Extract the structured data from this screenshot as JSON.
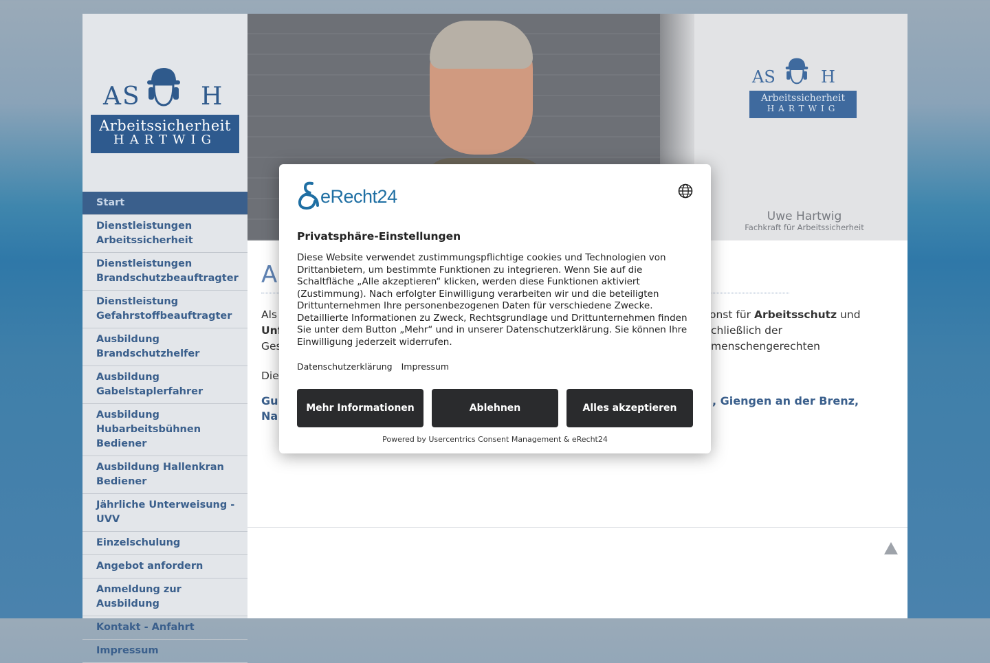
{
  "logo": {
    "letters_left": "AS",
    "letters_right": "H",
    "line1": "Arbeitssicherheit",
    "line2": "HARTWIG"
  },
  "nav": {
    "items": [
      {
        "label": "Start"
      },
      {
        "label": "Dienstleistungen Arbeitssicherheit"
      },
      {
        "label": "Dienstleistungen Brandschutzbeauftragter"
      },
      {
        "label": "Dienstleistung Gefahrstoffbeauftragter"
      },
      {
        "label": "Ausbildung Brandschutzhelfer"
      },
      {
        "label": "Ausbildung Gabelstaplerfahrer"
      },
      {
        "label": "Ausbildung Hubarbeitsbühnen Bediener"
      },
      {
        "label": "Ausbildung Hallenkran Bediener"
      },
      {
        "label": "Jährliche Unterweisung - UVV"
      },
      {
        "label": "Einzelschulung"
      },
      {
        "label": "Angebot anfordern"
      },
      {
        "label": "Anmeldung zur Ausbildung"
      },
      {
        "label": "Kontakt - Anfahrt"
      },
      {
        "label": "Impressum"
      }
    ]
  },
  "header": {
    "person_name": "Uwe Hartwig",
    "person_role": "Fachkraft für Arbeitssicherheit"
  },
  "content": {
    "heading": "A",
    "p1_start": "Als",
    "p1_tail": "onst für",
    "p1_bold1": "Arbeitsschutz",
    "p1_and": "und",
    "p2_start": "Unf",
    "p2_tail": "chließlich der menschengerechten",
    "p3_start": "Ges",
    "p4_start": "Die",
    "locations_start": "Gu",
    "locations_tail": ", Giengen an der Brenz,",
    "locations_l2": "Na"
  },
  "consent": {
    "brand": "eRecht24",
    "title": "Privatsphäre-Einstellungen",
    "description": "Diese Website verwendet zustimmungspflichtige cookies und Technologien von Drittanbietern, um bestimmte Funktionen zu integrieren. Wenn Sie auf die Schaltfläche „Alle akzeptieren“ klicken, werden diese Funktionen aktiviert (Zustimmung). Nach erfolgter Einwilligung verarbeiten wir und die beteiligten Drittunternehmen Ihre personenbezogenen Daten für verschiedene Zwecke. Detaillierte Informationen zu Zweck, Rechtsgrundlage und Drittunternehmen finden Sie unter dem Button „Mehr“ und in unserer Datenschutzerklärung. Sie können Ihre Einwilligung jederzeit widerrufen.",
    "link_privacy": "Datenschutzerklärung",
    "link_imprint": "Impressum",
    "btn_more": "Mehr Informationen",
    "btn_deny": "Ablehnen",
    "btn_accept": "Alles akzeptieren",
    "powered_by": "Powered by Usercentrics Consent Management & eRecht24"
  },
  "colors": {
    "nav_text": "#3a5f8c",
    "nav_active_bg": "#3a5f8c",
    "button_bg": "#2a2b2d",
    "brand_blue": "#1f6fa3"
  }
}
